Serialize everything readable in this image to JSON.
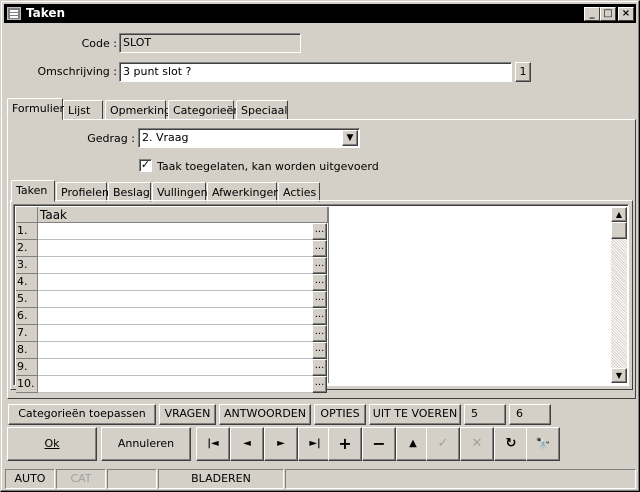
{
  "window": {
    "title": "Taken",
    "min": "_",
    "max": "□",
    "close": "×"
  },
  "form": {
    "code_label": "Code :",
    "code_value": "SLOT",
    "omschrijving_label": "Omschrijving :",
    "omschrijving_value": "3 punt slot ?",
    "omschrijving_badge": "1"
  },
  "main_tabs": [
    "Formulier",
    "Lijst",
    "Opmerking",
    "Categorieën",
    "Speciaal"
  ],
  "gedrag": {
    "label": "Gedrag :",
    "value": "2.  Vraag"
  },
  "checkbox": {
    "label": "Taak toegelaten, kan worden uitgevoerd",
    "checked": true
  },
  "sub_tabs": [
    "Taken",
    "Profielen",
    "Beslag",
    "Vullingen",
    "Afwerkingen",
    "Acties"
  ],
  "grid": {
    "column_header": "Taak",
    "rows": [
      "1.",
      "2.",
      "3.",
      "4.",
      "5.",
      "6.",
      "7.",
      "8.",
      "9.",
      "10."
    ],
    "ellipsis": "..."
  },
  "action_bar": {
    "categorieen": "Categorieën toepassen",
    "vragen": "VRAGEN",
    "antwoorden": "ANTWOORDEN",
    "opties": "OPTIES",
    "uit_te_voeren": "UIT TE VOEREN",
    "five": "5",
    "six": "6"
  },
  "buttons": {
    "ok": "Ok",
    "annuleren": "Annuleren"
  },
  "nav_icons": {
    "first": "|◄",
    "prev": "◄",
    "next": "►",
    "last": "►|",
    "add": "+",
    "remove": "−",
    "up": "▲",
    "confirm": "✓",
    "cancel": "✕",
    "refresh": "↻",
    "find": "🔭"
  },
  "statusbar": {
    "auto": "AUTO",
    "cat": "CAT",
    "empty": "",
    "mode": "BLADEREN"
  }
}
